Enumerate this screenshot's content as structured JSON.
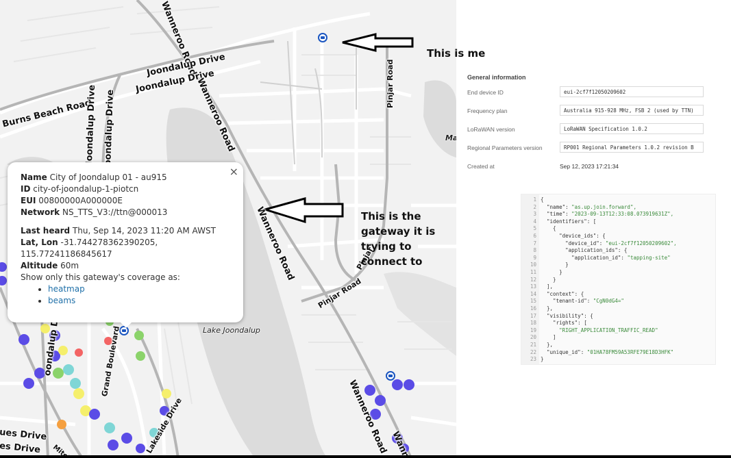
{
  "map": {
    "roads": {
      "joondalup_drive_1": "Joondalup Drive",
      "joondalup_drive_2": "Joondalup Drive",
      "joondalup_drive_v1": "Joondalup Drive",
      "joondalup_drive_v2": "Joondalup Drive",
      "joondalup_drive_v3": "oondalup Drive",
      "burns_beach": "Burns Beach Road",
      "wanneroo_1": "Wanneroo Road",
      "wanneroo_2": "Wanneroo Road",
      "wanneroo_3": "Wanneroo Road",
      "wanneroo_4": "Wanne",
      "wanneroo_top": "Wanneroo Road",
      "pinjar_1": "Pinjar Road",
      "pinjar_2": "Pinjar Road",
      "pinjar_3": "Pinjar",
      "grand_blvd": "Grand Boulevard",
      "lakeside": "Lakeside Drive",
      "ues_drive": "ues Drive",
      "es_drive": "es Drive",
      "mitch": "Mitch",
      "lake_joondalup": "Lake Joondalup",
      "ma": "Ma"
    },
    "annotations": {
      "me": "This is me",
      "gateway": "This is the gateway it is trying to connect to"
    }
  },
  "popup": {
    "name_label": "Name",
    "name_value": "City of Joondalup 01 - au915",
    "id_label": "ID",
    "id_value": "city-of-joondalup-1-piotcn",
    "eui_label": "EUI",
    "eui_value": "00800000A000000E",
    "network_label": "Network",
    "network_value": "NS_TTS_V3://ttn@000013",
    "last_heard_label": "Last heard",
    "last_heard_value": "Thu, Sep 14, 2023 11:20 AM AWST",
    "latlon_label": "Lat, Lon",
    "latlon_value_1": "-31.744278362390205,",
    "latlon_value_2": "115.77241186845617",
    "altitude_label": "Altitude",
    "altitude_value": "60m",
    "coverage_text": "Show only this gateway's coverage as:",
    "link_heatmap": "heatmap",
    "link_beams": "beams",
    "close": "×"
  },
  "device_info": {
    "title": "General information",
    "rows": [
      {
        "label": "End device ID",
        "value": "eui-2cf7f12050209602"
      },
      {
        "label": "Frequency plan",
        "value": "Australia 915-928 MHz, FSB 2 (used by TTN)"
      },
      {
        "label": "LoRaWAN version",
        "value": "LoRaWAN Specification 1.0.2"
      },
      {
        "label": "Regional Parameters version",
        "value": "RP001 Regional Parameters 1.0.2 revision B"
      },
      {
        "label": "Created at",
        "value": "Sep 12, 2023 17:21:34"
      }
    ]
  },
  "code_lines": [
    {
      "n": "1",
      "t": "{"
    },
    {
      "n": "2",
      "t": "  \"name\": \"as.up.join.forward\","
    },
    {
      "n": "3",
      "t": "  \"time\": \"2023-09-13T12:33:08.073919631Z\","
    },
    {
      "n": "4",
      "t": "  \"identifiers\": ["
    },
    {
      "n": "5",
      "t": "    {"
    },
    {
      "n": "6",
      "t": "      \"device_ids\": {"
    },
    {
      "n": "7",
      "t": "        \"device_id\": \"eui-2cf7f12050209602\","
    },
    {
      "n": "8",
      "t": "        \"application_ids\": {"
    },
    {
      "n": "9",
      "t": "          \"application_id\": \"tapping-site\""
    },
    {
      "n": "10",
      "t": "        }"
    },
    {
      "n": "11",
      "t": "      }"
    },
    {
      "n": "12",
      "t": "    }"
    },
    {
      "n": "13",
      "t": "  ],"
    },
    {
      "n": "14",
      "t": "  \"context\": {"
    },
    {
      "n": "15",
      "t": "    \"tenant-id\": \"CgN0dG4=\""
    },
    {
      "n": "16",
      "t": "  },"
    },
    {
      "n": "17",
      "t": "  \"visibility\": {"
    },
    {
      "n": "18",
      "t": "    \"rights\": ["
    },
    {
      "n": "19",
      "t": "      \"RIGHT_APPLICATION_TRAFFIC_READ\""
    },
    {
      "n": "20",
      "t": "    ]"
    },
    {
      "n": "21",
      "t": "  },"
    },
    {
      "n": "22",
      "t": "  \"unique_id\": \"01HA78FM59A53RFE79E18D3HFK\""
    },
    {
      "n": "23",
      "t": "}"
    }
  ]
}
